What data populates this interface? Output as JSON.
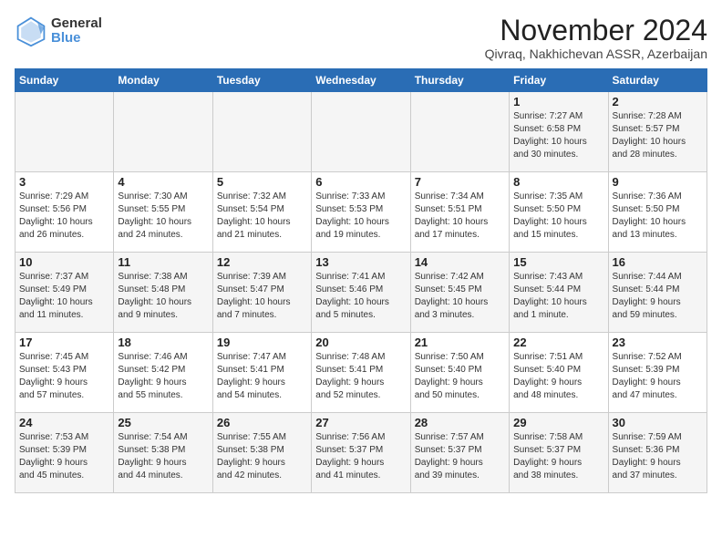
{
  "logo": {
    "general": "General",
    "blue": "Blue"
  },
  "title": "November 2024",
  "location": "Qivraq, Nakhichevan ASSR, Azerbaijan",
  "days_of_week": [
    "Sunday",
    "Monday",
    "Tuesday",
    "Wednesday",
    "Thursday",
    "Friday",
    "Saturday"
  ],
  "weeks": [
    [
      {
        "num": "",
        "info": ""
      },
      {
        "num": "",
        "info": ""
      },
      {
        "num": "",
        "info": ""
      },
      {
        "num": "",
        "info": ""
      },
      {
        "num": "",
        "info": ""
      },
      {
        "num": "1",
        "info": "Sunrise: 7:27 AM\nSunset: 6:58 PM\nDaylight: 10 hours\nand 30 minutes."
      },
      {
        "num": "2",
        "info": "Sunrise: 7:28 AM\nSunset: 5:57 PM\nDaylight: 10 hours\nand 28 minutes."
      }
    ],
    [
      {
        "num": "3",
        "info": "Sunrise: 7:29 AM\nSunset: 5:56 PM\nDaylight: 10 hours\nand 26 minutes."
      },
      {
        "num": "4",
        "info": "Sunrise: 7:30 AM\nSunset: 5:55 PM\nDaylight: 10 hours\nand 24 minutes."
      },
      {
        "num": "5",
        "info": "Sunrise: 7:32 AM\nSunset: 5:54 PM\nDaylight: 10 hours\nand 21 minutes."
      },
      {
        "num": "6",
        "info": "Sunrise: 7:33 AM\nSunset: 5:53 PM\nDaylight: 10 hours\nand 19 minutes."
      },
      {
        "num": "7",
        "info": "Sunrise: 7:34 AM\nSunset: 5:51 PM\nDaylight: 10 hours\nand 17 minutes."
      },
      {
        "num": "8",
        "info": "Sunrise: 7:35 AM\nSunset: 5:50 PM\nDaylight: 10 hours\nand 15 minutes."
      },
      {
        "num": "9",
        "info": "Sunrise: 7:36 AM\nSunset: 5:50 PM\nDaylight: 10 hours\nand 13 minutes."
      }
    ],
    [
      {
        "num": "10",
        "info": "Sunrise: 7:37 AM\nSunset: 5:49 PM\nDaylight: 10 hours\nand 11 minutes."
      },
      {
        "num": "11",
        "info": "Sunrise: 7:38 AM\nSunset: 5:48 PM\nDaylight: 10 hours\nand 9 minutes."
      },
      {
        "num": "12",
        "info": "Sunrise: 7:39 AM\nSunset: 5:47 PM\nDaylight: 10 hours\nand 7 minutes."
      },
      {
        "num": "13",
        "info": "Sunrise: 7:41 AM\nSunset: 5:46 PM\nDaylight: 10 hours\nand 5 minutes."
      },
      {
        "num": "14",
        "info": "Sunrise: 7:42 AM\nSunset: 5:45 PM\nDaylight: 10 hours\nand 3 minutes."
      },
      {
        "num": "15",
        "info": "Sunrise: 7:43 AM\nSunset: 5:44 PM\nDaylight: 10 hours\nand 1 minute."
      },
      {
        "num": "16",
        "info": "Sunrise: 7:44 AM\nSunset: 5:44 PM\nDaylight: 9 hours\nand 59 minutes."
      }
    ],
    [
      {
        "num": "17",
        "info": "Sunrise: 7:45 AM\nSunset: 5:43 PM\nDaylight: 9 hours\nand 57 minutes."
      },
      {
        "num": "18",
        "info": "Sunrise: 7:46 AM\nSunset: 5:42 PM\nDaylight: 9 hours\nand 55 minutes."
      },
      {
        "num": "19",
        "info": "Sunrise: 7:47 AM\nSunset: 5:41 PM\nDaylight: 9 hours\nand 54 minutes."
      },
      {
        "num": "20",
        "info": "Sunrise: 7:48 AM\nSunset: 5:41 PM\nDaylight: 9 hours\nand 52 minutes."
      },
      {
        "num": "21",
        "info": "Sunrise: 7:50 AM\nSunset: 5:40 PM\nDaylight: 9 hours\nand 50 minutes."
      },
      {
        "num": "22",
        "info": "Sunrise: 7:51 AM\nSunset: 5:40 PM\nDaylight: 9 hours\nand 48 minutes."
      },
      {
        "num": "23",
        "info": "Sunrise: 7:52 AM\nSunset: 5:39 PM\nDaylight: 9 hours\nand 47 minutes."
      }
    ],
    [
      {
        "num": "24",
        "info": "Sunrise: 7:53 AM\nSunset: 5:39 PM\nDaylight: 9 hours\nand 45 minutes."
      },
      {
        "num": "25",
        "info": "Sunrise: 7:54 AM\nSunset: 5:38 PM\nDaylight: 9 hours\nand 44 minutes."
      },
      {
        "num": "26",
        "info": "Sunrise: 7:55 AM\nSunset: 5:38 PM\nDaylight: 9 hours\nand 42 minutes."
      },
      {
        "num": "27",
        "info": "Sunrise: 7:56 AM\nSunset: 5:37 PM\nDaylight: 9 hours\nand 41 minutes."
      },
      {
        "num": "28",
        "info": "Sunrise: 7:57 AM\nSunset: 5:37 PM\nDaylight: 9 hours\nand 39 minutes."
      },
      {
        "num": "29",
        "info": "Sunrise: 7:58 AM\nSunset: 5:37 PM\nDaylight: 9 hours\nand 38 minutes."
      },
      {
        "num": "30",
        "info": "Sunrise: 7:59 AM\nSunset: 5:36 PM\nDaylight: 9 hours\nand 37 minutes."
      }
    ]
  ]
}
